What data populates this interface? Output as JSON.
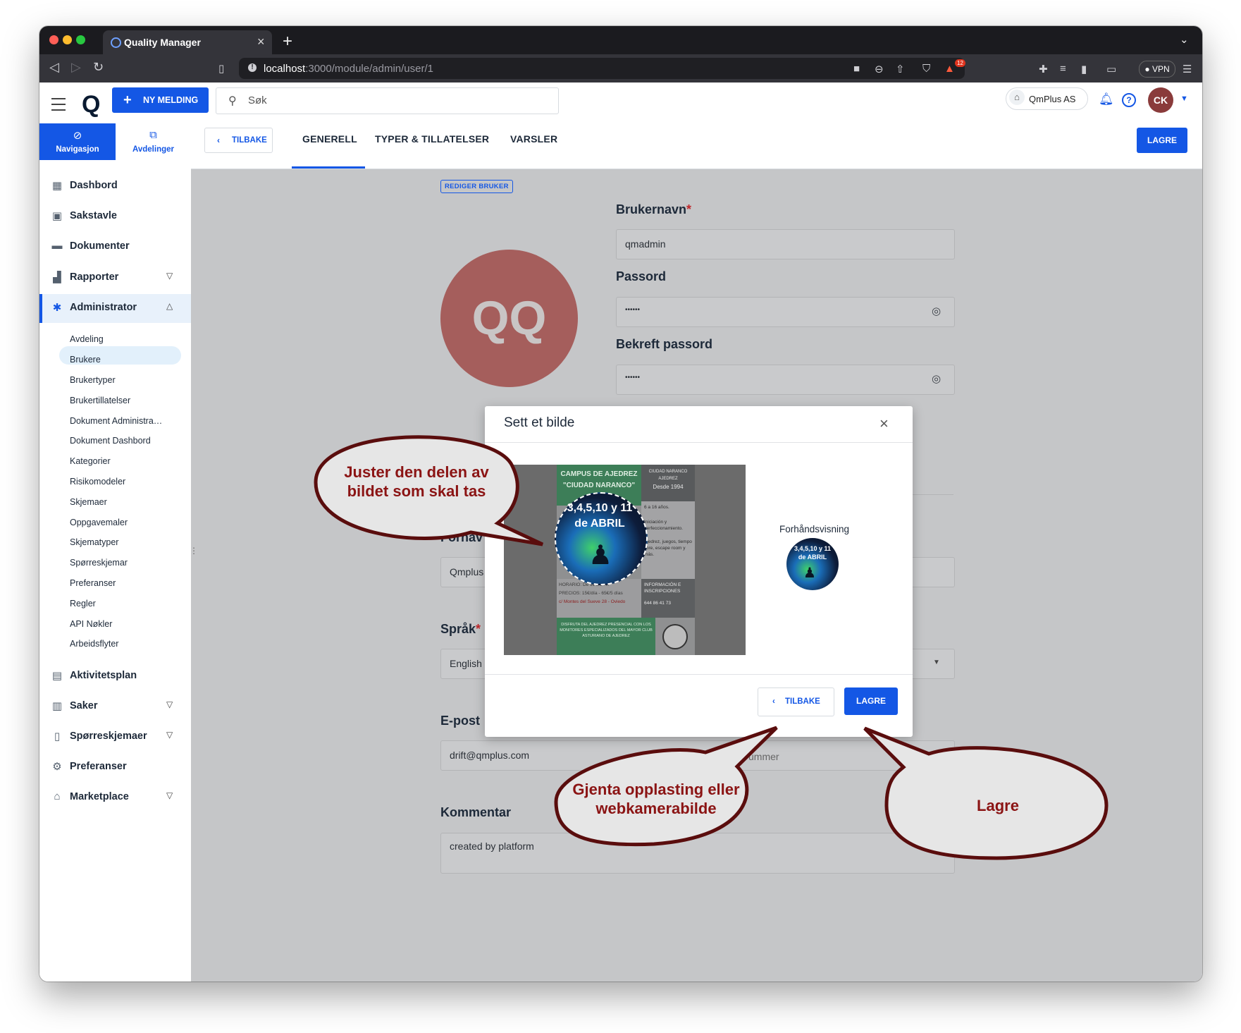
{
  "browser": {
    "tab_title": "Quality Manager",
    "url_host": "localhost",
    "url_path": ":3000/module/admin/user/1",
    "vpn_label": "VPN",
    "shield_badge": "12"
  },
  "header": {
    "new_message_label": "NY MELDING",
    "search_placeholder": "Søk",
    "company_name": "QmPlus AS",
    "avatar_initials": "CK"
  },
  "sidebar": {
    "tabs": [
      {
        "label": "Navigasjon",
        "icon": "compass-icon"
      },
      {
        "label": "Avdelinger",
        "icon": "org-chart-icon"
      }
    ],
    "items": [
      {
        "label": "Dashbord",
        "icon": "dashboard-icon"
      },
      {
        "label": "Sakstavle",
        "icon": "board-icon"
      },
      {
        "label": "Dokumenter",
        "icon": "folder-icon"
      },
      {
        "label": "Rapporter",
        "icon": "bar-chart-icon"
      },
      {
        "label": "Administrator",
        "icon": "admin-gear-icon"
      },
      {
        "label": "Aktivitetsplan",
        "icon": "calendar-icon"
      },
      {
        "label": "Saker",
        "icon": "cases-icon"
      },
      {
        "label": "Spørreskjemaer",
        "icon": "questionnaire-icon"
      },
      {
        "label": "Preferanser",
        "icon": "gear-icon"
      },
      {
        "label": "Marketplace",
        "icon": "store-icon"
      }
    ],
    "admin_subitems": [
      "Avdeling",
      "Brukere",
      "Brukertyper",
      "Brukertillatelser",
      "Dokument Administra…",
      "Dokument Dashbord",
      "Kategorier",
      "Risikomodeler",
      "Skjemaer",
      "Oppgavemaler",
      "Skjematyper",
      "Spørreskjemar",
      "Preferanser",
      "Regler",
      "API Nøkler",
      "Arbeidsflyter"
    ]
  },
  "toolbar": {
    "back_label": "TILBAKE",
    "tabs": [
      "GENERELL",
      "TYPER & TILLATELSER",
      "VARSLER"
    ],
    "active_tab": "GENERELL",
    "save_label": "LAGRE"
  },
  "form": {
    "badge": "REDIGER BRUKER",
    "avatar_initials": "QQ",
    "username_label": "Brukernavn",
    "username_value": "qmadmin",
    "password_label": "Passord",
    "password_value": "••••••",
    "confirm_label": "Bekreft passord",
    "confirm_value": "••••••",
    "firstname_label_partial": "Fornav",
    "firstname_value_partial": "Qmplus",
    "language_label": "Språk",
    "language_value": "English",
    "email_label_partial": "E-post",
    "email_value": "drift@qmplus.com",
    "phone_placeholder_partial": "ummer",
    "comment_label": "Kommentar",
    "comment_value": "created by platform",
    "required_mark": "*"
  },
  "modal": {
    "title": "Sett et bilde",
    "preview_label": "Forhåndsvisning",
    "back_label": "TILBAKE",
    "save_label": "LAGRE",
    "poster": {
      "title1": "CAMPUS DE AJEDREZ",
      "title2": "\"CIUDAD NARANCO\"",
      "club": "CIUDAD NARANCO AJEDREZ",
      "since": "Desde 1994",
      "dates": "3,4,5,10 y 11",
      "month": "de ABRIL",
      "ages": "6 a 16 años.",
      "line1": "Iniciación y perfeccionamiento.",
      "line2": "Ajedrez, juegos, tiempo libre, escape room y más.",
      "horario": "HORARIO: De 11 a 14 h",
      "precios": "PRECIOS: 15€/día - 65€/5 días",
      "address": "c/ Montes del Sueve 28 - Oviedo",
      "info": "INFORMACIÓN E INSCRIPCIONES",
      "phone": "644 86 41 73",
      "footer": "DISFRUTA DEL AJEDREZ PRESENCIAL CON LOS MONITORES ESPECIALIZADOS DEL MAYOR CLUB ASTURIANO DE AJEDREZ"
    }
  },
  "callouts": [
    {
      "text": "Juster den delen av bildet som skal tas"
    },
    {
      "text": "Gjenta opplasting eller webkamerabilde"
    },
    {
      "text": "Lagre"
    }
  ],
  "colors": {
    "accent": "#1457e5",
    "avatar_bg": "#a55e5c",
    "callout_text": "#8b1414",
    "callout_border": "#5a0d0d",
    "callout_fill": "#e6e6e6"
  }
}
